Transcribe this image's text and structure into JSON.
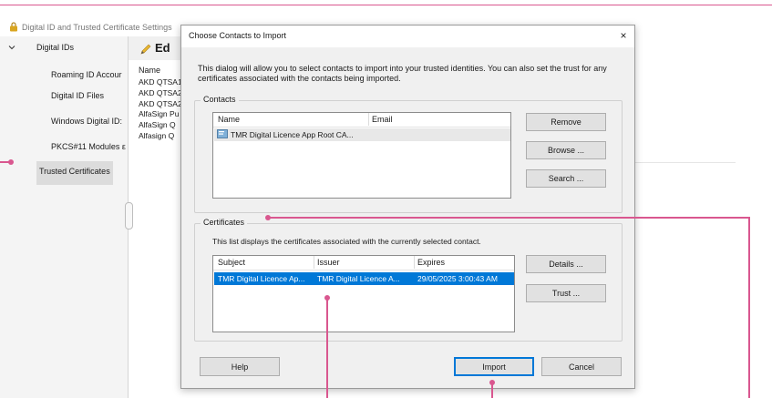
{
  "background_window": {
    "title": "Digital ID and Trusted Certificate Settings",
    "sidebar": {
      "root": "Digital IDs",
      "items": [
        {
          "label": "Roaming ID Accour"
        },
        {
          "label": "Digital ID Files"
        },
        {
          "label": "Windows Digital ID:"
        },
        {
          "label": "PKCS#11 Modules ε"
        }
      ],
      "selected": "Trusted Certificates"
    },
    "main": {
      "toolbar_edit": "Ed",
      "name_header": "Name",
      "rows": [
        {
          "name": "AKD QTSA1"
        },
        {
          "name": "AKD QTSA2"
        },
        {
          "name": "AKD QTSA2"
        },
        {
          "name": "AlfaSign Pu"
        },
        {
          "name": "AlfaSign Q"
        },
        {
          "name": "Alfasign Q"
        }
      ]
    }
  },
  "dialog": {
    "title": "Choose Contacts to Import",
    "close": "×",
    "description": "This dialog will allow you to select contacts to import into your trusted identities. You can also set the trust for any certificates associated with the contacts being imported.",
    "contacts": {
      "label": "Contacts",
      "columns": {
        "name": "Name",
        "email": "Email"
      },
      "rows": [
        {
          "name": "TMR Digital Licence App Root CA...",
          "email": ""
        }
      ],
      "buttons": {
        "remove": "Remove",
        "browse": "Browse ...",
        "search": "Search ..."
      }
    },
    "certificates": {
      "label": "Certificates",
      "info": "This list displays the certificates associated with the currently selected contact.",
      "columns": {
        "subject": "Subject",
        "issuer": "Issuer",
        "expires": "Expires"
      },
      "rows": [
        {
          "subject": "TMR Digital Licence Ap...",
          "issuer": "TMR Digital Licence A...",
          "expires": "29/05/2025 3:00:43 AM"
        }
      ],
      "buttons": {
        "details": "Details ...",
        "trust": "Trust ..."
      }
    },
    "footer": {
      "help": "Help",
      "import": "Import",
      "cancel": "Cancel"
    }
  },
  "colors": {
    "accent": "#d9578f",
    "selection": "#0078d7",
    "dialog_bg": "#f0f0f0"
  }
}
